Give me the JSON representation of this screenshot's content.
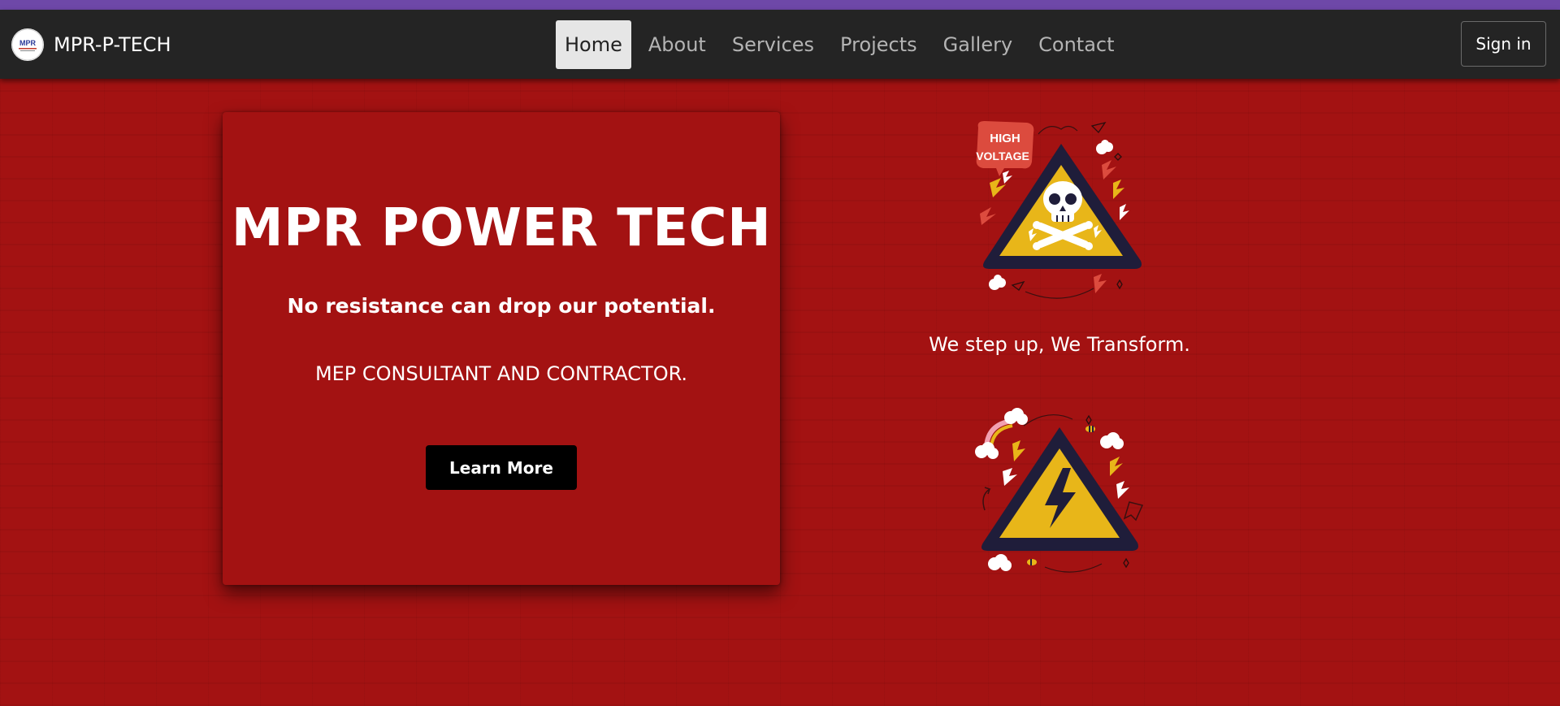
{
  "colors": {
    "top_strip": "#6e48a8",
    "navbar": "#242424",
    "background": "#a31212",
    "accent_yellow": "#e8b619",
    "dark_navy": "#1f1d3a",
    "button": "#000000"
  },
  "nav": {
    "brand_name": "MPR-P-TECH",
    "brand_logo_text": "MPR",
    "links": [
      {
        "label": "Home",
        "active": true
      },
      {
        "label": "About",
        "active": false
      },
      {
        "label": "Services",
        "active": false
      },
      {
        "label": "Projects",
        "active": false
      },
      {
        "label": "Gallery",
        "active": false
      },
      {
        "label": "Contact",
        "active": false
      }
    ],
    "signin_label": "Sign in"
  },
  "hero": {
    "title": "MPR POWER TECH",
    "tagline": "No resistance can drop our potential.",
    "subtitle": "MEP CONSULTANT AND CONTRACTOR.",
    "cta_label": "Learn More"
  },
  "side": {
    "badge_text": "HIGH VOLTAGE",
    "slogan": "We step up, We Transform.",
    "icons": [
      "skull-warning-illustration",
      "lightning-warning-illustration"
    ]
  }
}
